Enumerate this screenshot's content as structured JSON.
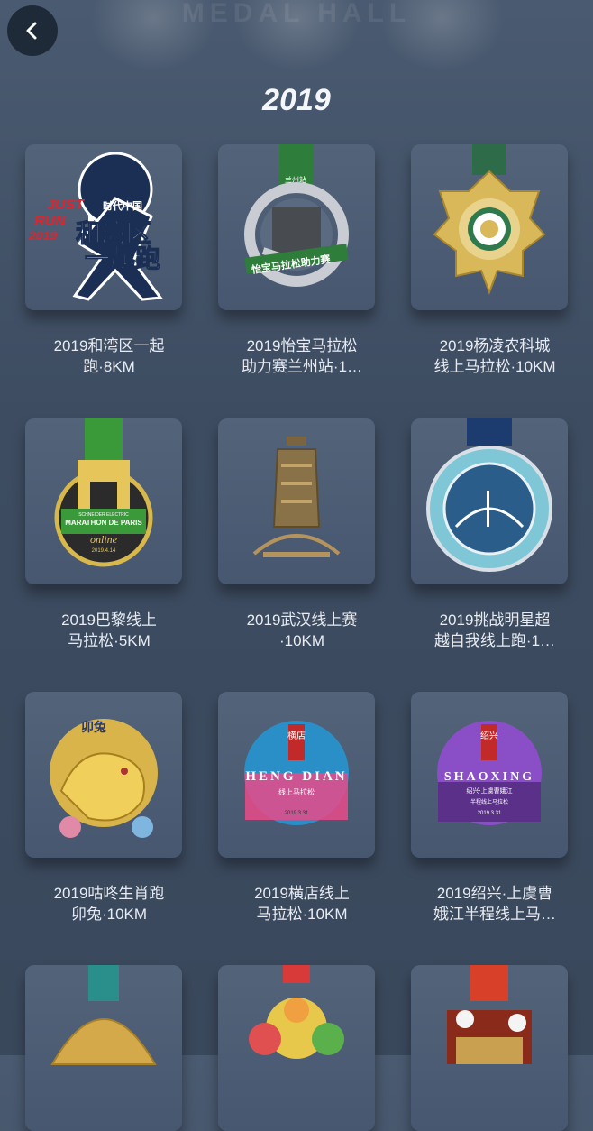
{
  "header": {
    "background_text": "MEDAL HALL",
    "year_title": "2019",
    "back_icon": "chevron-left-icon"
  },
  "medals": [
    {
      "line1": "2019和湾区一起",
      "line2": "跑·8KM",
      "art_text": [
        "JUST",
        "RUN",
        "2019",
        "时代中国",
        "和湾区",
        "一起跑"
      ]
    },
    {
      "line1": "2019怡宝马拉松",
      "line2": "助力赛兰州站·1…",
      "art_text": [
        "兰州站",
        "怡宝马拉松助力赛"
      ]
    },
    {
      "line1": "2019杨凌农科城",
      "line2": "线上马拉松·10KM",
      "art_text": []
    },
    {
      "line1": "2019巴黎线上",
      "line2": "马拉松·5KM",
      "art_text": [
        "SCHNEIDER ELECTRIC",
        "MARATHON DE PARIS",
        "online",
        "2019.4.14"
      ]
    },
    {
      "line1": "2019武汉线上赛",
      "line2": "·10KM",
      "art_text": []
    },
    {
      "line1": "2019挑战明星超",
      "line2": "越自我线上跑·1…",
      "art_text": []
    },
    {
      "line1": "2019咕咚生肖跑",
      "line2": "卯兔·10KM",
      "art_text": [
        "卯兔"
      ]
    },
    {
      "line1": "2019横店线上",
      "line2": "马拉松·10KM",
      "art_text": [
        "横店",
        "HENG DIAN",
        "线上马拉松",
        "2019.3.31"
      ]
    },
    {
      "line1": "2019绍兴·上虞曹",
      "line2": "娥江半程线上马…",
      "art_text": [
        "绍兴",
        "SHAOXING",
        "绍兴·上虞曹娥江",
        "半程线上马拉松",
        "2019.3.31"
      ]
    },
    {
      "line1": "",
      "line2": "",
      "art_text": []
    },
    {
      "line1": "",
      "line2": "",
      "art_text": []
    },
    {
      "line1": "",
      "line2": "",
      "art_text": []
    }
  ]
}
